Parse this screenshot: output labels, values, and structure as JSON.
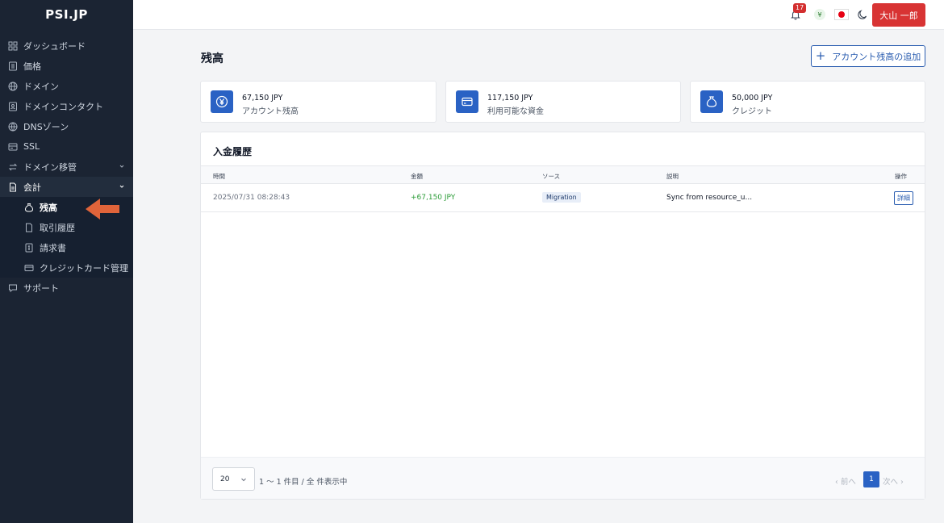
{
  "app": {
    "logo": "PSI.JP"
  },
  "sidebar": {
    "items": [
      {
        "label": "ダッシュボード",
        "icon": "dashboard-icon"
      },
      {
        "label": "価格",
        "icon": "price-icon"
      },
      {
        "label": "ドメイン",
        "icon": "globe-icon"
      },
      {
        "label": "ドメインコンタクト",
        "icon": "contact-icon"
      },
      {
        "label": "DNSゾーン",
        "icon": "dns-icon"
      },
      {
        "label": "SSL",
        "icon": "ssl-icon"
      },
      {
        "label": "ドメイン移管",
        "icon": "transfer-icon"
      },
      {
        "label": "会計",
        "icon": "accounting-icon"
      }
    ],
    "accounting_sub": [
      {
        "label": "残高",
        "icon": "moneybag-icon"
      },
      {
        "label": "取引履歴",
        "icon": "document-icon"
      },
      {
        "label": "請求書",
        "icon": "invoice-icon"
      },
      {
        "label": "クレジットカード管理",
        "icon": "credit-card-icon"
      }
    ],
    "support": {
      "label": "サポート",
      "icon": "chat-icon"
    }
  },
  "topbar": {
    "notification_count": "17",
    "currency_symbol": "¥",
    "user_name": "大山 一郎"
  },
  "page": {
    "title": "残高",
    "add_button": "アカウント残高の追加"
  },
  "stats": [
    {
      "value": "67,150 JPY",
      "label": "アカウント残高"
    },
    {
      "value": "117,150 JPY",
      "label": "利用可能な資金"
    },
    {
      "value": "50,000 JPY",
      "label": "クレジット"
    }
  ],
  "history": {
    "title": "入金履歴",
    "columns": [
      "時間",
      "金額",
      "ソース",
      "説明",
      "操作"
    ],
    "rows": [
      {
        "time": "2025/07/31 08:28:43",
        "amount": "+67,150 JPY",
        "source": "Migration",
        "description": "Sync from resource_u...",
        "action": "詳細"
      }
    ]
  },
  "pagination": {
    "page_size": "20",
    "info": "1 ～ 1 件目 / 全 件表示中",
    "prev": "前へ",
    "current": "1",
    "next": "次へ"
  },
  "colors": {
    "sidebar": "#1b2433",
    "primary": "#2a62c4",
    "user_button": "#d83434",
    "positive": "#2e9d3a",
    "annotation_arrow": "#e0643a"
  }
}
